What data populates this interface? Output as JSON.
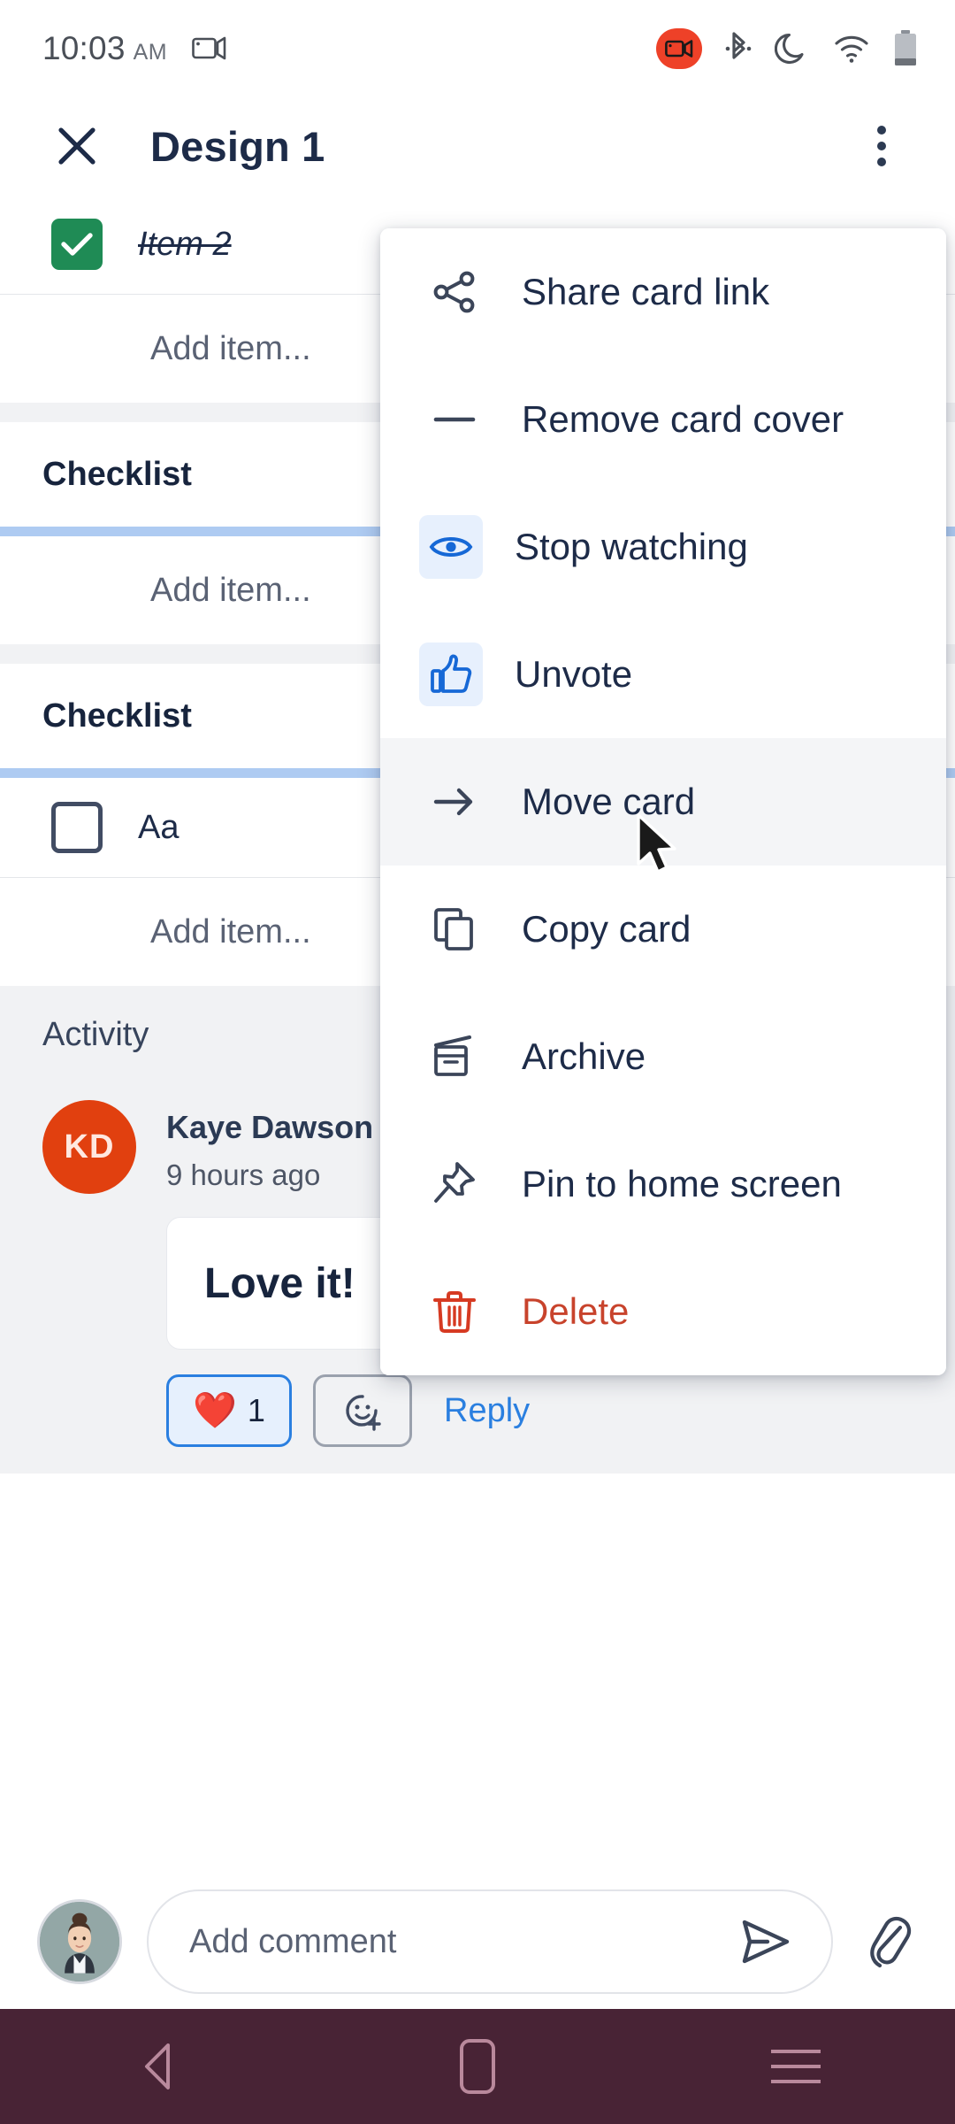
{
  "status_bar": {
    "time": "10:03",
    "ampm": "AM",
    "icons": [
      "screen-cast-icon",
      "screen-record-icon",
      "bluetooth-icon",
      "do-not-disturb-icon",
      "wifi-icon",
      "battery-icon"
    ]
  },
  "header": {
    "close_icon": "close-icon",
    "title": "Design 1",
    "overflow_icon": "kebab-menu-icon"
  },
  "card": {
    "checklist_top": {
      "item": {
        "label": "Item 2",
        "checked": true
      },
      "add_item": "Add item..."
    },
    "checklist_1": {
      "title": "Checklist",
      "add_item": "Add item...",
      "progress_percent": 100
    },
    "checklist_2": {
      "title": "Checklist",
      "item": {
        "label": "Aa",
        "checked": false
      },
      "add_item": "Add item...",
      "progress_percent": 100
    }
  },
  "activity": {
    "heading": "Activity",
    "comment": {
      "avatar_initials": "KD",
      "avatar_color": "#e1400f",
      "author": "Kaye Dawson",
      "timestamp": "9 hours ago",
      "body": "Love it!",
      "reaction": {
        "emoji": "❤️",
        "count": "1"
      },
      "add_reaction_icon": "add-reaction-icon",
      "reply_label": "Reply",
      "overflow_icon": "kebab-menu-icon"
    }
  },
  "menu": {
    "items": [
      {
        "label": "Share card link",
        "icon": "share-icon",
        "highlighted": false,
        "danger": false,
        "badge": false
      },
      {
        "label": "Remove card cover",
        "icon": "minus-icon",
        "highlighted": false,
        "danger": false,
        "badge": false
      },
      {
        "label": "Stop watching",
        "icon": "eye-icon",
        "highlighted": false,
        "danger": false,
        "badge": true
      },
      {
        "label": "Unvote",
        "icon": "thumbs-up-icon",
        "highlighted": false,
        "danger": false,
        "badge": true
      },
      {
        "label": "Move card",
        "icon": "arrow-right-icon",
        "highlighted": true,
        "danger": false,
        "badge": false
      },
      {
        "label": "Copy card",
        "icon": "copy-icon",
        "highlighted": false,
        "danger": false,
        "badge": false
      },
      {
        "label": "Archive",
        "icon": "archive-icon",
        "highlighted": false,
        "danger": false,
        "badge": false
      },
      {
        "label": "Pin to home screen",
        "icon": "pin-icon",
        "highlighted": false,
        "danger": false,
        "badge": false
      },
      {
        "label": "Delete",
        "icon": "trash-icon",
        "highlighted": false,
        "danger": true,
        "badge": false
      }
    ]
  },
  "comment_bar": {
    "avatar": "user-avatar",
    "placeholder": "Add comment",
    "send_icon": "send-icon",
    "attach_icon": "paperclip-icon"
  },
  "nav_bar": {
    "back": "back-icon",
    "home": "home-icon",
    "recents": "recents-icon",
    "color": "#482335"
  },
  "colors": {
    "accent_blue": "#2a7fe0",
    "checkbox_green": "#1f8b55",
    "danger_red": "#c8432c",
    "progress_blue": "#aecbf2",
    "activity_bg": "#f1f2f4"
  }
}
